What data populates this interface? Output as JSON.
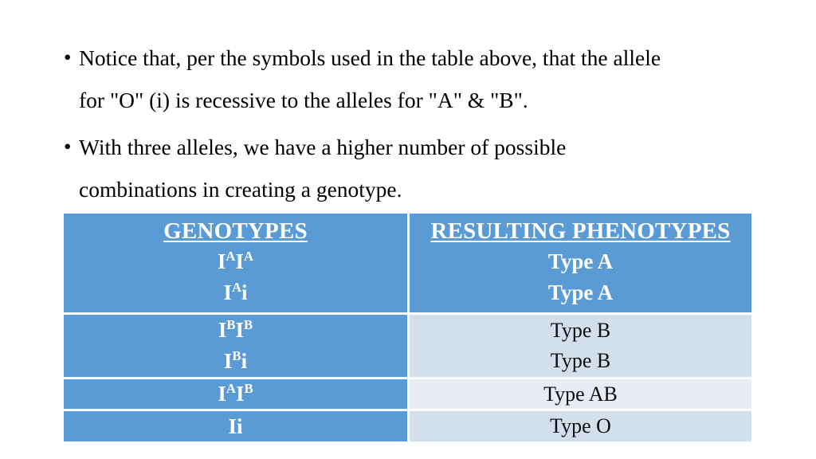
{
  "slide": {
    "background_color": "#ffffff",
    "bullets": [
      {
        "marker": "•",
        "line1": "Notice that, per the symbols used in the table above, that the allele",
        "line2": "for \"O\" (i) is recessive to the alleles for \"A\" & \"B\"."
      },
      {
        "marker": "•",
        "line1": "With three alleles, we have a higher number of possible",
        "line2": "combinations in creating a genotype."
      }
    ]
  },
  "table": {
    "accent_color": "#5b9bd5",
    "alt_row_dark": "#d4dfec",
    "alt_row_light": "#e9ecf6",
    "headers": {
      "genotypes": "GENOTYPES",
      "phenotypes": "RESULTING PHENOTYPES"
    },
    "rows": [
      {
        "genotype_base": "I",
        "genotype_sup1": "A",
        "genotype_mid": "I",
        "genotype_sup2": "A",
        "genotype_plain": "",
        "phenotype": "Type A"
      },
      {
        "genotype_base": "I",
        "genotype_sup1": "A",
        "genotype_mid": "i",
        "genotype_sup2": "",
        "genotype_plain": "",
        "phenotype": "Type A"
      },
      {
        "genotype_base": "I",
        "genotype_sup1": "B",
        "genotype_mid": "I",
        "genotype_sup2": "B",
        "genotype_plain": "",
        "phenotype": "Type B"
      },
      {
        "genotype_base": "I",
        "genotype_sup1": "B",
        "genotype_mid": "i",
        "genotype_sup2": "",
        "genotype_plain": "",
        "phenotype": "Type B"
      },
      {
        "genotype_base": "I",
        "genotype_sup1": "A",
        "genotype_mid": "I",
        "genotype_sup2": "B",
        "genotype_plain": "",
        "phenotype": "Type AB"
      },
      {
        "genotype_base": "",
        "genotype_sup1": "",
        "genotype_mid": "",
        "genotype_sup2": "",
        "genotype_plain": "Ii",
        "phenotype": "Type O"
      }
    ]
  }
}
